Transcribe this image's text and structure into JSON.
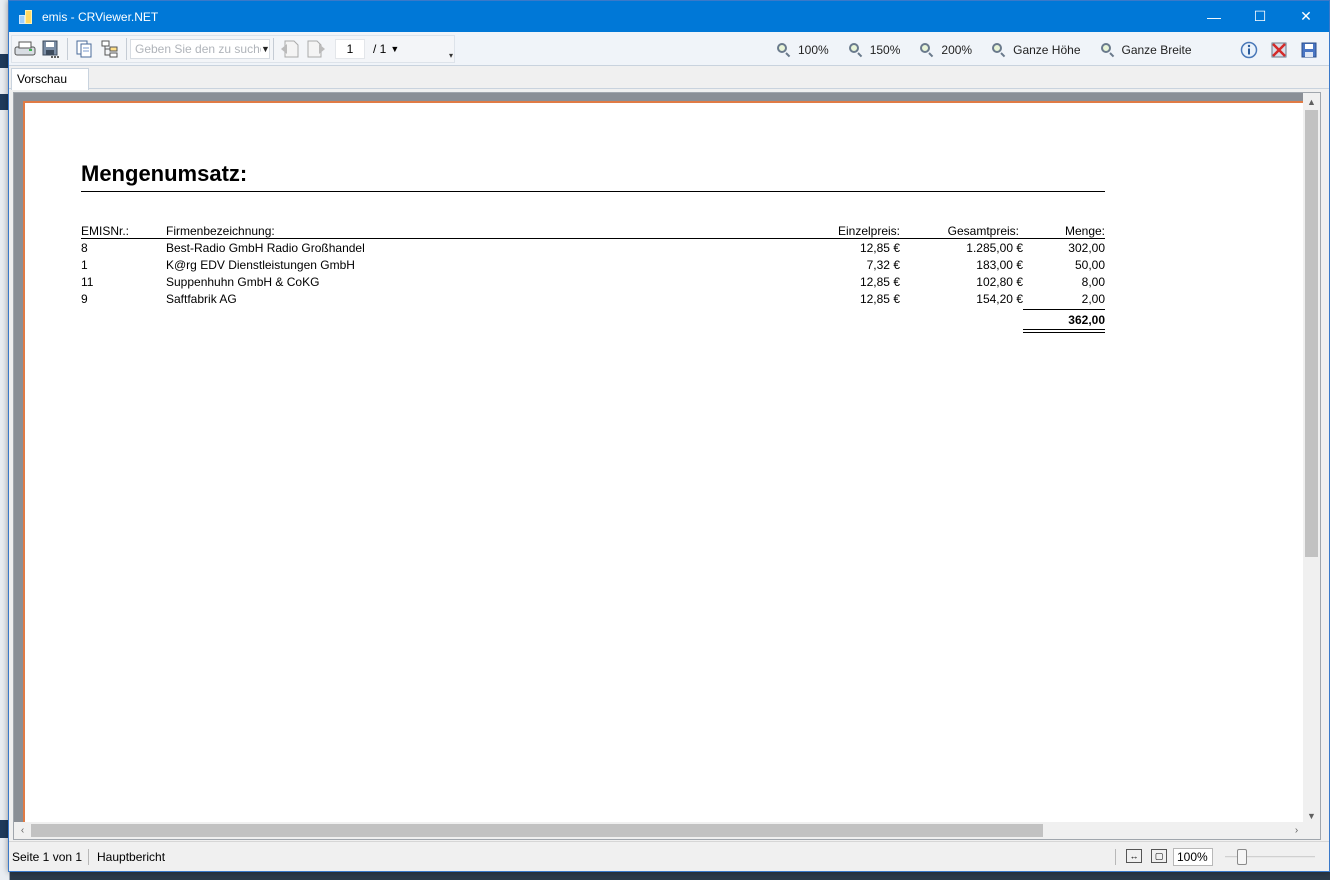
{
  "window": {
    "title": "emis - CRViewer.NET",
    "controls": {
      "minimize": "—",
      "maximize": "☐",
      "close": "✕"
    }
  },
  "toolbar": {
    "search_placeholder": "Geben Sie den zu suchen",
    "current_page": "1",
    "page_total": "/ 1",
    "zoom_buttons": [
      "100%",
      "150%",
      "200%",
      "Ganze Höhe",
      "Ganze Breite"
    ],
    "icons": [
      "print-icon",
      "export-icon",
      "copy-icon",
      "group-tree-icon",
      "prev-page-icon",
      "next-page-icon",
      "info-icon",
      "close-report-icon",
      "save-icon"
    ]
  },
  "tabs": [
    {
      "label": "Vorschau"
    }
  ],
  "report": {
    "title": "Mengenumsatz:",
    "columns": {
      "emis_nr": "EMISNr.:",
      "firma": "Firmenbezeichnung:",
      "einzelpreis": "Einzelpreis:",
      "gesamtpreis": "Gesamtpreis:",
      "menge": "Menge:"
    },
    "rows": [
      {
        "emis_nr": "8",
        "firma": "Best-Radio GmbH Radio Großhandel",
        "einzelpreis": "12,85 €",
        "gesamtpreis": "1.285,00 €",
        "menge": "302,00"
      },
      {
        "emis_nr": "1",
        "firma": "K@rg EDV Dienstleistungen GmbH",
        "einzelpreis": "7,32 €",
        "gesamtpreis": "183,00 €",
        "menge": "50,00"
      },
      {
        "emis_nr": "11",
        "firma": "Suppenhuhn GmbH & CoKG",
        "einzelpreis": "12,85 €",
        "gesamtpreis": "102,80 €",
        "menge": "8,00"
      },
      {
        "emis_nr": "9",
        "firma": "Saftfabrik AG",
        "einzelpreis": "12,85 €",
        "gesamtpreis": "154,20 €",
        "menge": "2,00"
      }
    ],
    "total_menge": "362,00"
  },
  "statusbar": {
    "page_info": "Seite 1 von 1",
    "report_name": "Hauptbericht",
    "zoom": "100%"
  }
}
